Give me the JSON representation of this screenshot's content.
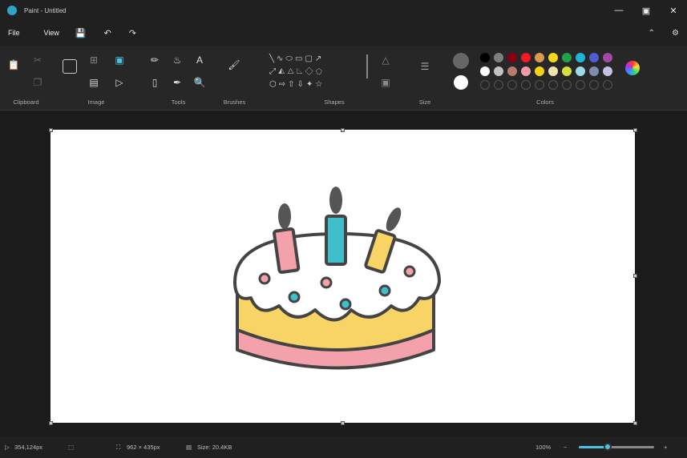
{
  "title": "Paint - Untitled",
  "menu": {
    "file": "File",
    "view": "View"
  },
  "groups": {
    "clipboard": "Clipboard",
    "image": "Image",
    "tools": "Tools",
    "brushes": "Brushes",
    "shapes": "Shapes",
    "size": "Size",
    "colors": "Colors"
  },
  "colors_row1": [
    "#000000",
    "#7f7f7f",
    "#880015",
    "#ed1c24",
    "#d99a4e",
    "#f7d81d",
    "#22a04b",
    "#1fb5d8",
    "#4b5fd1",
    "#a349a4"
  ],
  "colors_row2": [
    "#ffffff",
    "#c3c3c3",
    "#b97a72",
    "#f29aa8",
    "#f5d50a",
    "#efe4b0",
    "#d7e03b",
    "#99d9ea",
    "#7f8cb0",
    "#c8bfe7"
  ],
  "status": {
    "cursor": "354,124px",
    "dimensions": "962 × 435px",
    "size": "Size: 20.4KB",
    "zoom": "100%"
  },
  "zoom_fraction": 0.38
}
